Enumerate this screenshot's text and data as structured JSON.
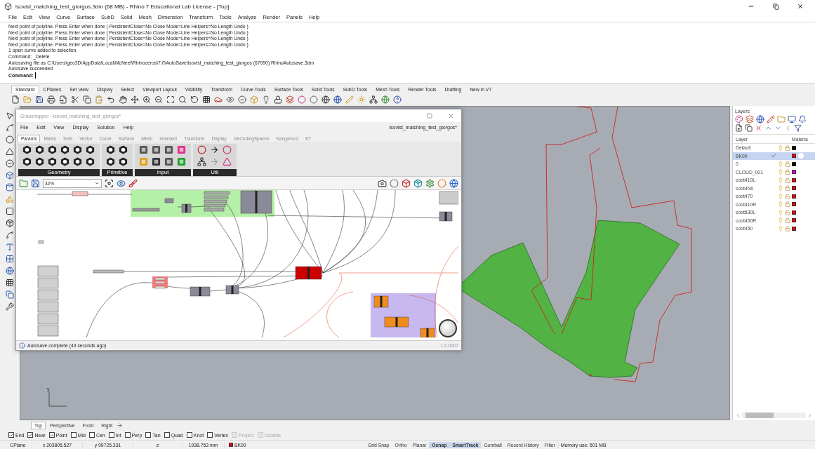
{
  "window": {
    "title": "isovist_matching_test_giorgos.3dm (68 MB) - Rhino 7 Educational Lab License - [Top]"
  },
  "menu": [
    "File",
    "Edit",
    "View",
    "Curve",
    "Surface",
    "SubD",
    "Solid",
    "Mesh",
    "Dimension",
    "Transform",
    "Tools",
    "Analyze",
    "Render",
    "Panels",
    "Help"
  ],
  "command_history": [
    "Next point of polyline. Press Enter when done ( PersistentClose=No  Close  Mode=Line  Helpers=No  Length  Undo )",
    "Next point of polyline. Press Enter when done ( PersistentClose=No  Close  Mode=Line  Helpers=No  Length  Undo )",
    "Next point of polyline. Press Enter when done ( PersistentClose=No  Close  Mode=Line  Helpers=No  Length  Undo )",
    "Next point of polyline. Press Enter when done ( PersistentClose=No  Close  Mode=Line  Helpers=No  Length  Undo )",
    "1 open curve added to selection.",
    "Command: _Delete",
    "Autosaving file as C:\\Users\\geo3D\\AppData\\Local\\McNeel\\Rhinoceros\\7.0\\AutoSave\\isovist_matching_test_giorgos (67090) RhinoAutosave.3dm",
    "Autosave succeeded"
  ],
  "command_prompt": {
    "label": "Command:"
  },
  "toolbar_tabs": [
    {
      "label": "Standard",
      "selected": true
    },
    {
      "label": "CPlanes",
      "selected": false
    },
    {
      "label": "Set View",
      "selected": false
    },
    {
      "label": "Display",
      "selected": false
    },
    {
      "label": "Select",
      "selected": false
    },
    {
      "label": "Viewport Layout",
      "selected": false
    },
    {
      "label": "Visibility",
      "selected": false
    },
    {
      "label": "Transform",
      "selected": false
    },
    {
      "label": "Curve Tools",
      "selected": false
    },
    {
      "label": "Surface Tools",
      "selected": false
    },
    {
      "label": "Solid Tools",
      "selected": false
    },
    {
      "label": "SubD Tools",
      "selected": false
    },
    {
      "label": "Mesh Tools",
      "selected": false
    },
    {
      "label": "Render Tools",
      "selected": false
    },
    {
      "label": "Drafting",
      "selected": false
    },
    {
      "label": "New in V7",
      "selected": false
    }
  ],
  "grasshopper": {
    "title": "Grasshopper - isovist_matching_test_giorgos*",
    "menu": [
      "File",
      "Edit",
      "View",
      "Display",
      "Solution",
      "Help"
    ],
    "document": "isovist_matching_test_giorgos*",
    "tabs": [
      {
        "label": "Params",
        "selected": true
      },
      {
        "label": "Maths",
        "selected": false
      },
      {
        "label": "Sets",
        "selected": false
      },
      {
        "label": "Vector",
        "selected": false
      },
      {
        "label": "Curve",
        "selected": false
      },
      {
        "label": "Surface",
        "selected": false
      },
      {
        "label": "Mesh",
        "selected": false
      },
      {
        "label": "Intersect",
        "selected": false
      },
      {
        "label": "Transform",
        "selected": false
      },
      {
        "label": "Display",
        "selected": false
      },
      {
        "label": "DeCodingSpaces",
        "selected": false
      },
      {
        "label": "Kangaroo2",
        "selected": false
      },
      {
        "label": "KT",
        "selected": false
      }
    ],
    "ribbon_groups": [
      {
        "label": "Geometry",
        "kind": "geometry"
      },
      {
        "label": "Primitive",
        "kind": "primitive"
      },
      {
        "label": "Input",
        "kind": "input"
      },
      {
        "label": "Util",
        "kind": "util"
      }
    ],
    "zoom": "32%",
    "status": "Autosave complete (43 seconds ago)",
    "version": "1.0.0007"
  },
  "viewport": {
    "axis_label": "y"
  },
  "layers": {
    "title": "Layers",
    "columns": [
      "Layer",
      "Materia"
    ],
    "rows": [
      {
        "name": "Default",
        "selected": false,
        "current": false,
        "color": "#000000"
      },
      {
        "name": "BK00",
        "selected": true,
        "current": true,
        "color": "#ff0000"
      },
      {
        "name": "0",
        "selected": false,
        "current": false,
        "color": "#000000"
      },
      {
        "name": "CLOUD_001",
        "selected": false,
        "current": false,
        "color": "#e000e0"
      },
      {
        "name": "coot410L",
        "selected": false,
        "current": false,
        "color": "#ff0000"
      },
      {
        "name": "coot4N0",
        "selected": false,
        "current": false,
        "color": "#ff0000"
      },
      {
        "name": "coot470",
        "selected": false,
        "current": false,
        "color": "#ff0000"
      },
      {
        "name": "coot410R",
        "selected": false,
        "current": false,
        "color": "#ff0000"
      },
      {
        "name": "coot530L",
        "selected": false,
        "current": false,
        "color": "#ff0000"
      },
      {
        "name": "coot450R",
        "selected": false,
        "current": false,
        "color": "#ff0000"
      },
      {
        "name": "coot450",
        "selected": false,
        "current": false,
        "color": "#ff0000"
      }
    ]
  },
  "viewport_tabs": [
    {
      "label": "Top",
      "selected": true
    },
    {
      "label": "Perspective",
      "selected": false
    },
    {
      "label": "Front",
      "selected": false
    },
    {
      "label": "Right",
      "selected": false
    }
  ],
  "osnaps": [
    {
      "label": "End",
      "checked": true,
      "disabled": false
    },
    {
      "label": "Near",
      "checked": true,
      "disabled": false
    },
    {
      "label": "Point",
      "checked": true,
      "disabled": false
    },
    {
      "label": "Mid",
      "checked": false,
      "disabled": false
    },
    {
      "label": "Cen",
      "checked": false,
      "disabled": false
    },
    {
      "label": "Int",
      "checked": false,
      "disabled": false
    },
    {
      "label": "Perp",
      "checked": false,
      "disabled": false
    },
    {
      "label": "Tan",
      "checked": false,
      "disabled": false
    },
    {
      "label": "Quad",
      "checked": false,
      "disabled": false
    },
    {
      "label": "Knot",
      "checked": false,
      "disabled": false
    },
    {
      "label": "Vertex",
      "checked": false,
      "disabled": false
    },
    {
      "label": "Project",
      "checked": false,
      "disabled": true
    },
    {
      "label": "Disable",
      "checked": false,
      "disabled": true
    }
  ],
  "status_bar": {
    "cplane": "CPlane",
    "x": "x 203805.527",
    "y": "y 99725.331",
    "z": "z",
    "distance": "1938.753 mm",
    "layer": {
      "name": "BK00",
      "color": "#ff0000"
    },
    "toggles": [
      {
        "label": "Grid Snap",
        "on": false
      },
      {
        "label": "Ortho",
        "on": false
      },
      {
        "label": "Planar",
        "on": false
      },
      {
        "label": "Osnap",
        "on": true
      },
      {
        "label": "SmartTrack",
        "on": true
      },
      {
        "label": "Gumball",
        "on": false
      },
      {
        "label": "Record History",
        "on": false
      },
      {
        "label": "Filter",
        "on": false
      }
    ],
    "memory": "Memory use: 501 MB"
  }
}
